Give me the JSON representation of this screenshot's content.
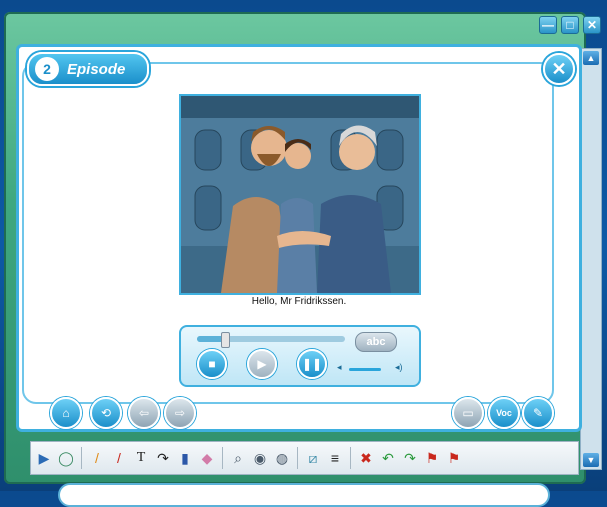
{
  "window": {
    "buttons": [
      {
        "name": "minimize-button",
        "glyph": "—"
      },
      {
        "name": "maximize-button",
        "glyph": "□"
      },
      {
        "name": "window-close-button",
        "glyph": "✕"
      }
    ]
  },
  "episode": {
    "number": "2",
    "title": "Episode"
  },
  "close_glyph": "✕",
  "scene": {
    "caption": "Hello, Mr Fridrikssen."
  },
  "player": {
    "subtitle_toggle": "abc",
    "progress": 0.18,
    "volume": 0.72,
    "controls": [
      {
        "name": "stop-button",
        "glyph": "■"
      },
      {
        "name": "play-button",
        "glyph": "▶"
      },
      {
        "name": "pause-button",
        "glyph": "❚❚"
      }
    ]
  },
  "nav_left": [
    {
      "name": "home-button",
      "glyph": "⌂"
    },
    {
      "name": "refresh-button",
      "glyph": "⟲"
    },
    {
      "name": "back-button",
      "glyph": "⇦"
    },
    {
      "name": "forward-button",
      "glyph": "⇨"
    }
  ],
  "nav_right": [
    {
      "name": "slideshow-button",
      "glyph": "▭"
    },
    {
      "name": "vocabulary-button",
      "glyph": "Voc"
    },
    {
      "name": "note-button",
      "glyph": "✎"
    }
  ],
  "toolbar": [
    {
      "name": "select-pointer-tool",
      "glyph": "▶",
      "color": "#2b6bb5"
    },
    {
      "name": "lasso-tool",
      "glyph": "◯",
      "color": "#3a8a63"
    },
    {
      "name": "pen-orange-tool",
      "glyph": "/",
      "color": "#e08a16"
    },
    {
      "name": "pen-red-tool",
      "glyph": "/",
      "color": "#c9281d"
    },
    {
      "name": "text-tool",
      "glyph": "T",
      "color": "#222222"
    },
    {
      "name": "curve-tool",
      "glyph": "↷",
      "color": "#222222"
    },
    {
      "name": "marker-tool",
      "glyph": "▮",
      "color": "#2b57a8"
    },
    {
      "name": "eraser-tool",
      "glyph": "◆",
      "color": "#d27ba8"
    },
    {
      "name": "zoom-tool",
      "glyph": "⌕",
      "color": "#4a5a6a"
    },
    {
      "name": "spotlight-tool",
      "glyph": "◉",
      "color": "#4a5a6a"
    },
    {
      "name": "reveal-tool",
      "glyph": "◍",
      "color": "#4a5a6a"
    },
    {
      "name": "screen-shade-tool",
      "glyph": "⧄",
      "color": "#3a8aa8"
    },
    {
      "name": "blind-tool",
      "glyph": "≡",
      "color": "#222222"
    },
    {
      "name": "clear-tool",
      "glyph": "✖",
      "color": "#c9281d"
    },
    {
      "name": "undo-tool",
      "glyph": "↶",
      "color": "#2b9a3d"
    },
    {
      "name": "redo-tool",
      "glyph": "↷",
      "color": "#2b9a3d"
    },
    {
      "name": "bookmark-tool",
      "glyph": "⚑",
      "color": "#c9281d"
    },
    {
      "name": "bookmark-save-tool",
      "glyph": "⚑",
      "color": "#c9281d"
    }
  ],
  "colors": {
    "accent": "#2aa5db",
    "frame": "#3fa880",
    "background": "#0d5aa6"
  }
}
